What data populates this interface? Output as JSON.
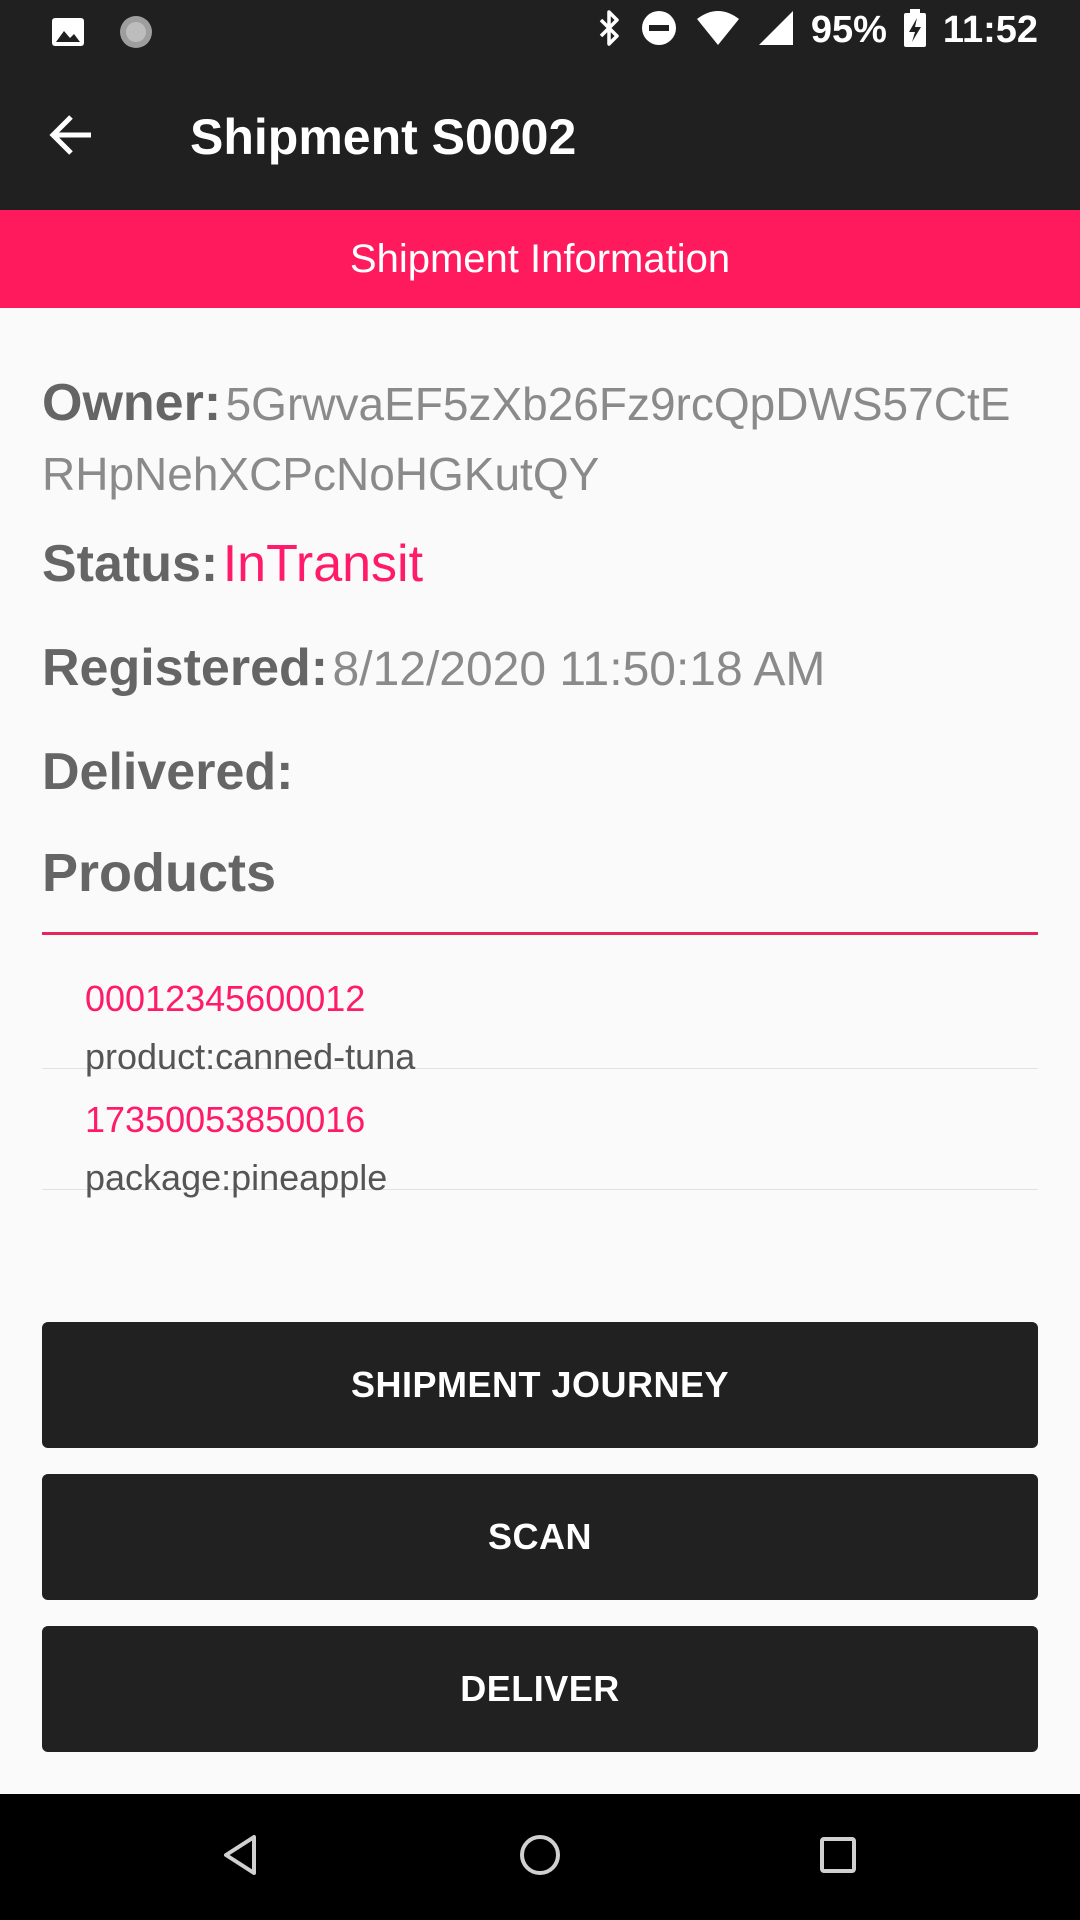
{
  "status_bar": {
    "battery": "95%",
    "time": "11:52",
    "icons": [
      "image-icon",
      "sync-icon",
      "bluetooth-icon",
      "do-not-disturb-icon",
      "wifi-icon",
      "signal-icon",
      "battery-charging-icon"
    ]
  },
  "app_bar": {
    "title": "Shipment S0002",
    "back_icon": "arrow-back-icon"
  },
  "banner": {
    "label": "Shipment Information"
  },
  "shipment": {
    "owner_label": "Owner:",
    "owner_value": "5GrwvaEF5zXb26Fz9rcQpDWS57CtERHpNehXCPcNoHGKutQY",
    "status_label": "Status:",
    "status_value": "InTransit",
    "registered_label": "Registered:",
    "registered_value": "8/12/2020 11:50:18 AM",
    "delivered_label": "Delivered:",
    "delivered_value": ""
  },
  "products": {
    "heading": "Products",
    "items": [
      {
        "code": "00012345600012",
        "desc": "product:canned-tuna"
      },
      {
        "code": "17350053850016",
        "desc": "package:pineapple"
      }
    ]
  },
  "actions": {
    "journey_label": "SHIPMENT JOURNEY",
    "scan_label": "SCAN",
    "deliver_label": "DELIVER"
  },
  "colors": {
    "accent": "#ff1a5e",
    "dark": "#212121",
    "background": "#fafafa"
  }
}
